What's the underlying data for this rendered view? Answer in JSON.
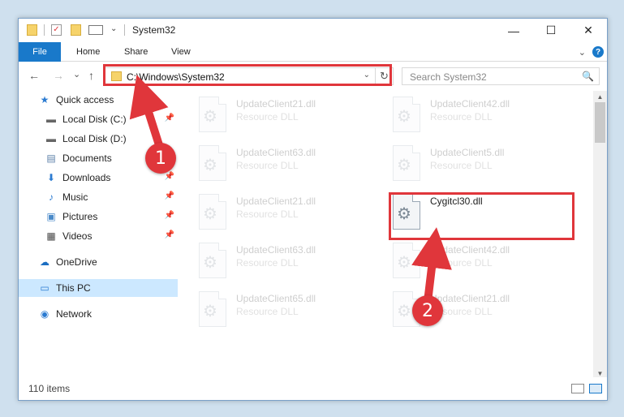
{
  "window": {
    "title": "System32",
    "min_glyph": "—",
    "max_glyph": "☐",
    "close_glyph": "✕"
  },
  "ribbon": {
    "tabs": [
      "File",
      "Home",
      "Share",
      "View"
    ],
    "chevron": "⌄",
    "help": "?"
  },
  "nav": {
    "back": "←",
    "forward": "→",
    "recent": "⌄",
    "up": "↑"
  },
  "address": {
    "path": "C:\\Windows\\System32",
    "dropdown": "⌄",
    "refresh": "↻"
  },
  "search": {
    "placeholder": "Search System32",
    "icon": "🔍"
  },
  "sidebar": {
    "items": [
      {
        "label": "Quick access",
        "icon": "star-icon",
        "glyph": "★",
        "pinned": false
      },
      {
        "label": "Local Disk (C:)",
        "icon": "drive-icon",
        "glyph": "▬",
        "pinned": true
      },
      {
        "label": "Local Disk (D:)",
        "icon": "drive-icon",
        "glyph": "▬",
        "pinned": false
      },
      {
        "label": "Documents",
        "icon": "documents-icon",
        "glyph": "▤",
        "pinned": true
      },
      {
        "label": "Downloads",
        "icon": "download-icon",
        "glyph": "⬇",
        "pinned": true
      },
      {
        "label": "Music",
        "icon": "music-icon",
        "glyph": "♪",
        "pinned": true
      },
      {
        "label": "Pictures",
        "icon": "pictures-icon",
        "glyph": "▣",
        "pinned": true
      },
      {
        "label": "Videos",
        "icon": "videos-icon",
        "glyph": "▦",
        "pinned": true
      },
      {
        "label": "OneDrive",
        "icon": "onedrive-icon",
        "glyph": "☁",
        "pinned": false
      },
      {
        "label": "This PC",
        "icon": "pc-icon",
        "glyph": "▭",
        "pinned": false,
        "selected": true
      },
      {
        "label": "Network",
        "icon": "network-icon",
        "glyph": "◉",
        "pinned": false
      }
    ],
    "pin_glyph": "📌"
  },
  "files": [
    {
      "name": "UpdateClient21.dll",
      "desc": "Resource DLL",
      "faded": true
    },
    {
      "name": "UpdateClient42.dll",
      "desc": "Resource DLL",
      "faded": true
    },
    {
      "name": "UpdateClient63.dll",
      "desc": "Resource DLL",
      "faded": true
    },
    {
      "name": "UpdateClient5.dll",
      "desc": "Resource DLL",
      "faded": true
    },
    {
      "name": "UpdateClient21.dll",
      "desc": "Resource DLL",
      "faded": true
    },
    {
      "name": "Cygitcl30.dll",
      "desc": "",
      "faded": false
    },
    {
      "name": "UpdateClient63.dll",
      "desc": "Resource DLL",
      "faded": true
    },
    {
      "name": "UpdateClient42.dll",
      "desc": "Resource DLL",
      "faded": true
    },
    {
      "name": "UpdateClient65.dll",
      "desc": "Resource DLL",
      "faded": true
    },
    {
      "name": "UpdateClient21.dll",
      "desc": "Resource DLL",
      "faded": true
    }
  ],
  "status": {
    "count": "110 items"
  },
  "callouts": [
    "1",
    "2"
  ],
  "colors": {
    "accent": "#1979ca",
    "highlight": "#e0363b",
    "selected": "#cce8ff"
  }
}
